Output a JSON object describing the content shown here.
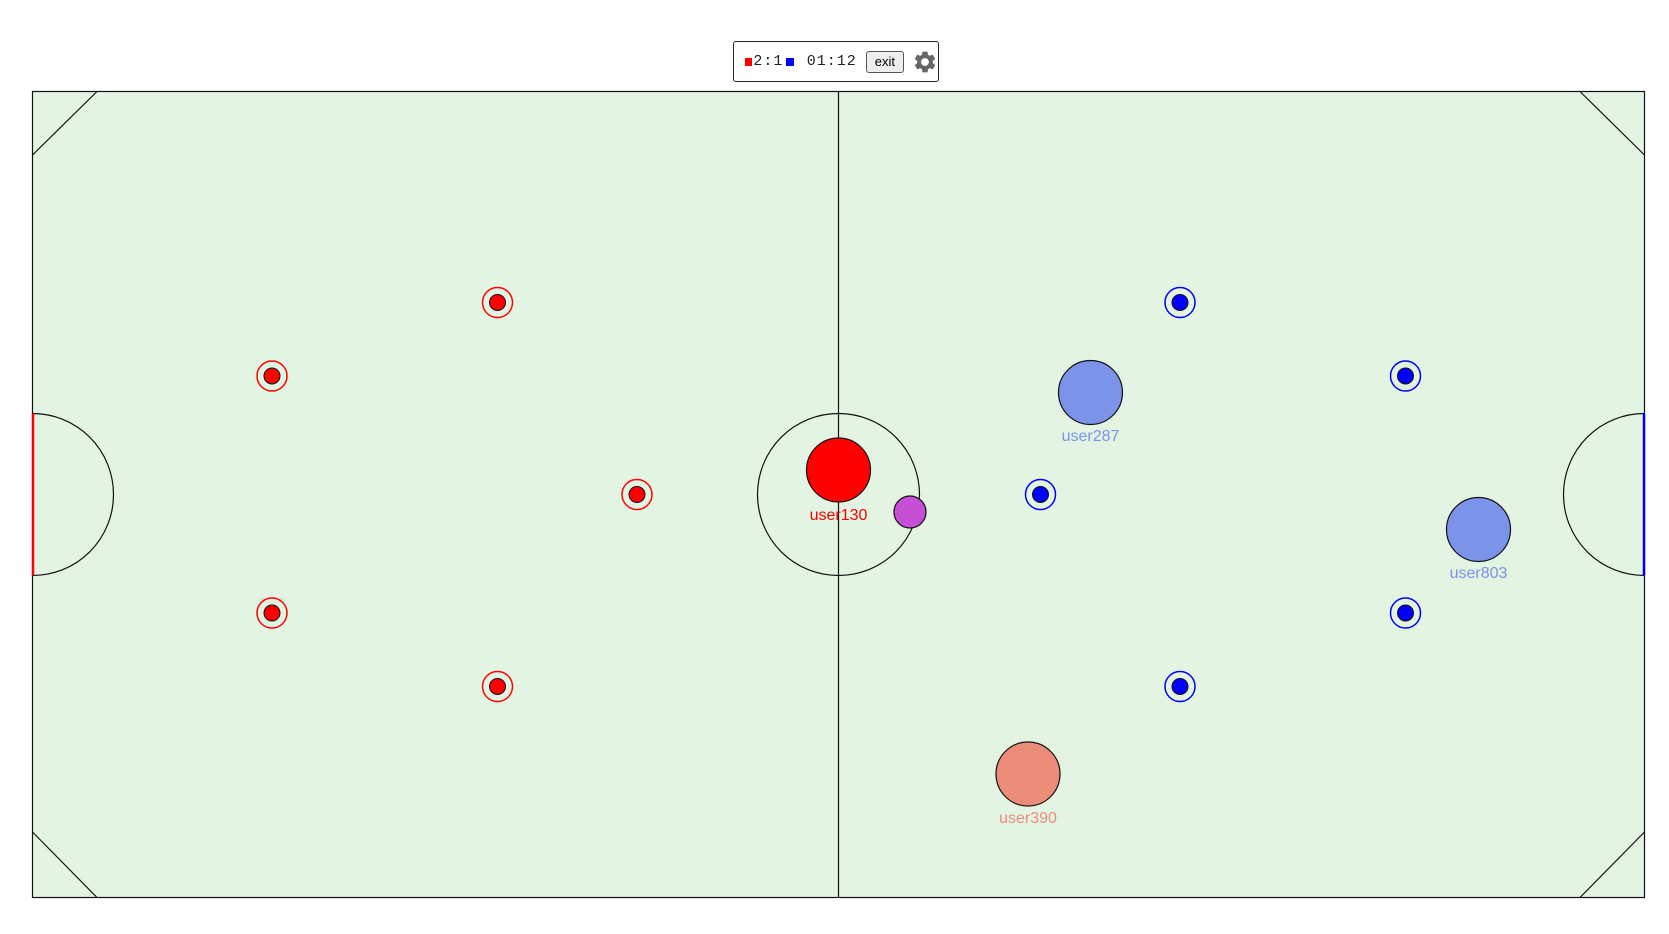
{
  "hud": {
    "score": "2:1",
    "timer": "01:12",
    "exit_label": "exit",
    "settings_icon": "gear-icon",
    "red_color": "#ff0000",
    "blue_color": "#0000ff"
  },
  "colors": {
    "field": "#e3f4e2",
    "lines": "#111111",
    "red_goal": "#ff0000",
    "blue_goal": "#0000ff",
    "ball": "#c64fd6",
    "red_marker": "#ff0000",
    "blue_marker": "#0000ff"
  },
  "players": [
    {
      "name": "user130",
      "color": "#ff0000",
      "label_color": "#ff0000"
    },
    {
      "name": "user287",
      "color": "#7b93e8",
      "label_color": "#7b93e8"
    },
    {
      "name": "user803",
      "color": "#7b93e8",
      "label_color": "#7b93e8"
    },
    {
      "name": "user390",
      "color": "#ec8d7a",
      "label_color": "#ec8d7a"
    }
  ]
}
